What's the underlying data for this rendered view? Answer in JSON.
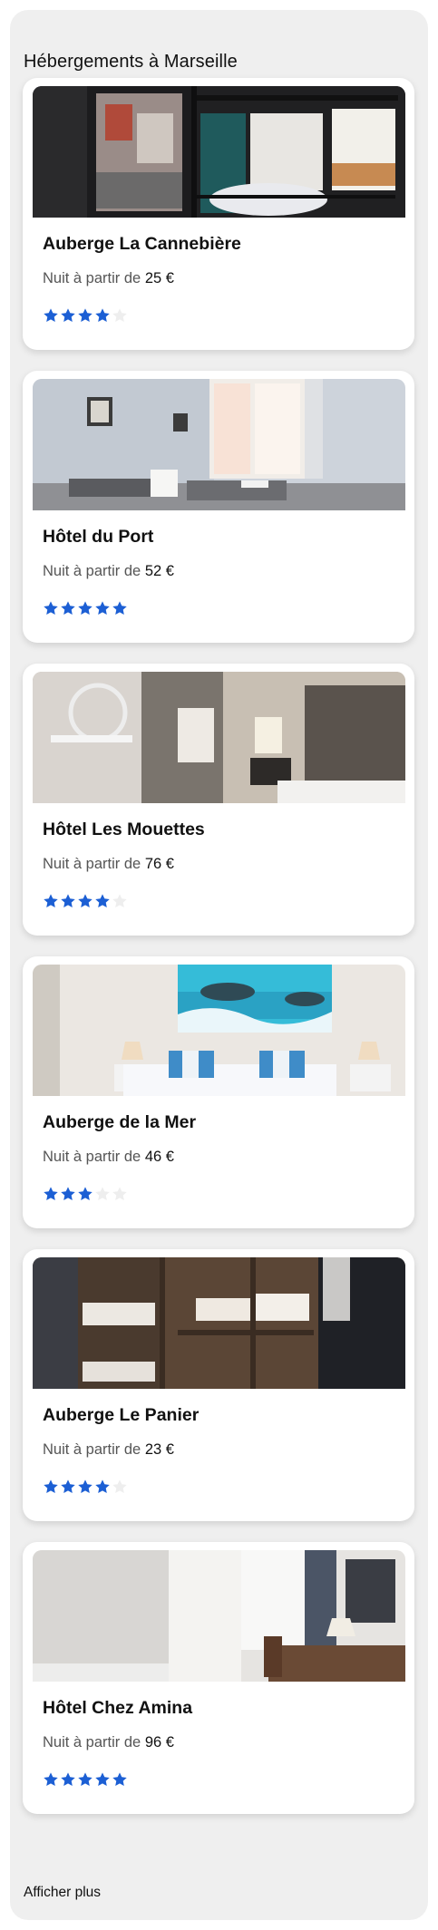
{
  "section": {
    "title": "Hébergements à Marseille"
  },
  "price_prefix": "Nuit à partir de",
  "listings": [
    {
      "name": "Auberge La Cannebière",
      "price": "25 €",
      "rating": 4,
      "photo": "dormitory-bunk-window-icon"
    },
    {
      "name": "Hôtel du Port",
      "price": "52 €",
      "rating": 5,
      "photo": "twin-room-window-icon"
    },
    {
      "name": "Hôtel Les Mouettes",
      "price": "76 €",
      "rating": 4,
      "photo": "room-mirror-lamp-icon"
    },
    {
      "name": "Auberge de la Mer",
      "price": "46 €",
      "rating": 3,
      "photo": "sea-painting-bedroom-icon"
    },
    {
      "name": "Auberge Le Panier",
      "price": "23 €",
      "rating": 4,
      "photo": "wooden-bunks-icon"
    },
    {
      "name": "Hôtel Chez Amina",
      "price": "96 €",
      "rating": 5,
      "photo": "bright-room-desk-icon"
    }
  ],
  "footer": {
    "more_label": "Afficher plus"
  },
  "colors": {
    "star_on": "#1c5fd4",
    "star_off": "#eeeeee",
    "panel": "#efefef"
  }
}
